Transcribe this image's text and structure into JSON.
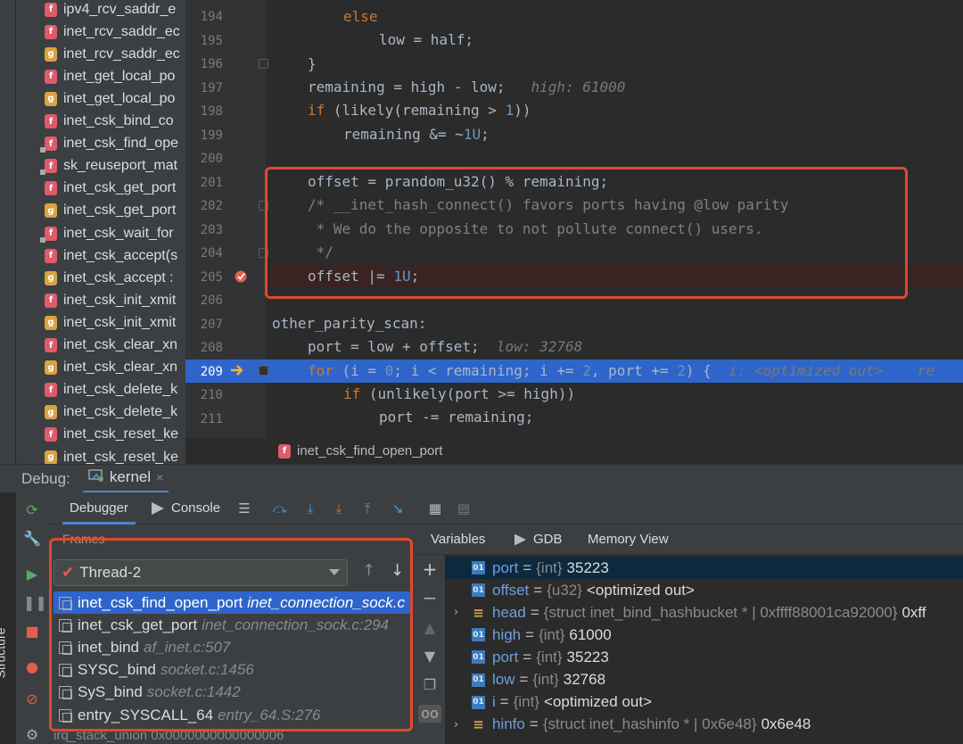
{
  "structure": {
    "tab_label": "Structure",
    "functions": [
      {
        "badge": "f",
        "label": "ipv4_rcv_saddr_e"
      },
      {
        "badge": "f",
        "label": "inet_rcv_saddr_ec"
      },
      {
        "badge": "g",
        "label": "inet_rcv_saddr_ec"
      },
      {
        "badge": "f",
        "label": "inet_get_local_po"
      },
      {
        "badge": "g",
        "label": "inet_get_local_po"
      },
      {
        "badge": "f",
        "label": "inet_csk_bind_co"
      },
      {
        "badge": "f",
        "label": "inet_csk_find_ope"
      },
      {
        "badge": "f",
        "label": "sk_reuseport_mat"
      },
      {
        "badge": "f",
        "label": "inet_csk_get_port"
      },
      {
        "badge": "g",
        "label": "inet_csk_get_port"
      },
      {
        "badge": "f",
        "label": "inet_csk_wait_for"
      },
      {
        "badge": "f",
        "label": "inet_csk_accept(s"
      },
      {
        "badge": "g",
        "label": "inet_csk_accept :"
      },
      {
        "badge": "f",
        "label": "inet_csk_init_xmit"
      },
      {
        "badge": "g",
        "label": "inet_csk_init_xmit"
      },
      {
        "badge": "f",
        "label": "inet_csk_clear_xn"
      },
      {
        "badge": "g",
        "label": "inet_csk_clear_xn"
      },
      {
        "badge": "f",
        "label": "inet_csk_delete_k"
      },
      {
        "badge": "g",
        "label": "inet_csk_delete_k"
      },
      {
        "badge": "f",
        "label": "inet_csk_reset_ke"
      },
      {
        "badge": "g",
        "label": "inet_csk_reset_ke"
      }
    ]
  },
  "editor": {
    "line_numbers": [
      "194",
      "195",
      "196",
      "197",
      "198",
      "199",
      "200",
      "201",
      "202",
      "203",
      "204",
      "205",
      "206",
      "207",
      "208",
      "209",
      "210",
      "211"
    ],
    "code": {
      "l194_kw": "else",
      "l195": "low = half;",
      "l196": "}",
      "l197": "remaining = high - low;",
      "l197_hint": "high: 61000",
      "l198_kw": "if",
      "l198_a": " (likely(remaining > ",
      "l198_num": "1",
      "l198_b": "))",
      "l199_a": "remaining &= ~",
      "l199_num": "1U",
      "l199_b": ";",
      "l201": "offset = prandom_u32() % remaining;",
      "l202": "/* __inet_hash_connect() favors ports having @low parity",
      "l203": " * We do the opposite to not pollute connect() users.",
      "l204": " */",
      "l205_a": "offset |= ",
      "l205_num": "1U",
      "l205_b": ";",
      "l207": "other_parity_scan:",
      "l208": "port = low + offset;",
      "l208_hint": "low: 32768",
      "l209_kw": "for",
      "l209_a": " (i = ",
      "l209_n1": "0",
      "l209_b": "; i < remaining; i += ",
      "l209_n2": "2",
      "l209_c": ", port += ",
      "l209_n3": "2",
      "l209_d": ") {",
      "l209_hint": "i: <optimized out>    re",
      "l210_kw": "if",
      "l210_a": " (unlikely(port >= high))",
      "l211": "port -= remaining;"
    },
    "breadcrumb": "inet_csk_find_open_port",
    "breadcrumb_badge": "f"
  },
  "debug": {
    "title": "Debug:",
    "session_tab": "kernel",
    "session_close": "×",
    "tabs": {
      "debugger": "Debugger",
      "console": "Console"
    },
    "frames_label": "Frames",
    "thread": "Thread-2",
    "frames": [
      {
        "name": "inet_csk_find_open_port",
        "loc": "inet_connection_sock.c"
      },
      {
        "name": "inet_csk_get_port",
        "loc": "inet_connection_sock.c:294"
      },
      {
        "name": "inet_bind",
        "loc": "af_inet.c:507"
      },
      {
        "name": "SYSC_bind",
        "loc": "socket.c:1456"
      },
      {
        "name": "SyS_bind",
        "loc": "socket.c:1442"
      },
      {
        "name": "entry_SYSCALL_64",
        "loc": "entry_64.S:276"
      }
    ],
    "irq_row": "irq_stack_union 0x0000000000000006",
    "var_tabs": {
      "variables": "Variables",
      "gdb": "GDB",
      "memory": "Memory View"
    },
    "variables": [
      {
        "name": "port",
        "type": "{int}",
        "value": "35223",
        "kind": "prim",
        "expandable": false
      },
      {
        "name": "offset",
        "type": "{u32}",
        "value": "<optimized out>",
        "kind": "prim",
        "expandable": false
      },
      {
        "name": "head",
        "type": "{struct inet_bind_hashbucket * | 0xffff88001ca92000}",
        "value": "0xff",
        "kind": "struct",
        "expandable": true
      },
      {
        "name": "high",
        "type": "{int}",
        "value": "61000",
        "kind": "prim",
        "expandable": false
      },
      {
        "name": "port",
        "type": "{int}",
        "value": "35223",
        "kind": "prim",
        "expandable": false
      },
      {
        "name": "low",
        "type": "{int}",
        "value": "32768",
        "kind": "prim",
        "expandable": false
      },
      {
        "name": "i",
        "type": "{int}",
        "value": "<optimized out>",
        "kind": "prim",
        "expandable": false
      },
      {
        "name": "hinfo",
        "type": "{struct inet_hashinfo * | 0x6e48}",
        "value": "0x6e48",
        "kind": "struct",
        "expandable": true
      }
    ]
  },
  "colors": {
    "accent": "#2f65ca",
    "highlight_box": "#e0482c",
    "breakpoint": "#e0604b"
  }
}
